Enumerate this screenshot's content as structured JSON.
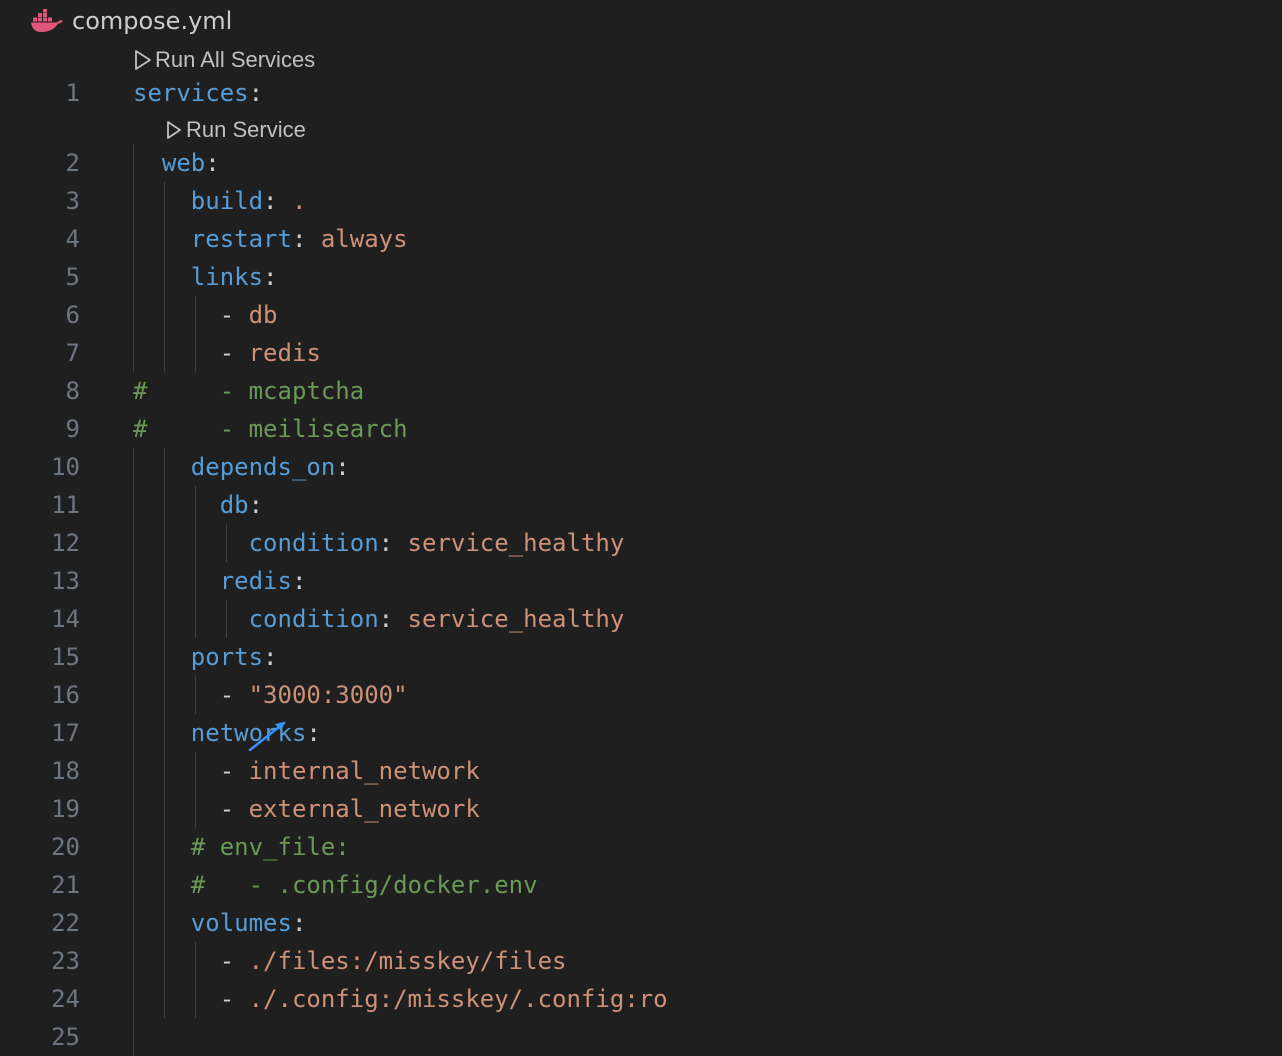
{
  "breadcrumb": {
    "icon": "docker-whale-icon",
    "filename": "compose.yml"
  },
  "codelens": {
    "run_all": "Run All Services",
    "run_service": "Run Service"
  },
  "lines": [
    {
      "n": "1",
      "tokens": [
        {
          "t": "services",
          "c": "k"
        },
        {
          "t": ":",
          "c": "p"
        }
      ]
    },
    {
      "n": "2",
      "tokens": [
        {
          "t": "  ",
          "c": "p"
        },
        {
          "t": "web",
          "c": "k"
        },
        {
          "t": ":",
          "c": "p"
        }
      ]
    },
    {
      "n": "3",
      "tokens": [
        {
          "t": "    ",
          "c": "p"
        },
        {
          "t": "build",
          "c": "k"
        },
        {
          "t": ": ",
          "c": "p"
        },
        {
          "t": ".",
          "c": "s"
        }
      ]
    },
    {
      "n": "4",
      "tokens": [
        {
          "t": "    ",
          "c": "p"
        },
        {
          "t": "restart",
          "c": "k"
        },
        {
          "t": ": ",
          "c": "p"
        },
        {
          "t": "always",
          "c": "s"
        }
      ]
    },
    {
      "n": "5",
      "tokens": [
        {
          "t": "    ",
          "c": "p"
        },
        {
          "t": "links",
          "c": "k"
        },
        {
          "t": ":",
          "c": "p"
        }
      ]
    },
    {
      "n": "6",
      "tokens": [
        {
          "t": "      - ",
          "c": "p"
        },
        {
          "t": "db",
          "c": "s"
        }
      ]
    },
    {
      "n": "7",
      "tokens": [
        {
          "t": "      - ",
          "c": "p"
        },
        {
          "t": "redis",
          "c": "s"
        }
      ]
    },
    {
      "n": "8",
      "tokens": [
        {
          "t": "#     - mcaptcha",
          "c": "c"
        }
      ]
    },
    {
      "n": "9",
      "tokens": [
        {
          "t": "#     - meilisearch",
          "c": "c"
        }
      ]
    },
    {
      "n": "10",
      "tokens": [
        {
          "t": "    ",
          "c": "p"
        },
        {
          "t": "depends_on",
          "c": "k"
        },
        {
          "t": ":",
          "c": "p"
        }
      ]
    },
    {
      "n": "11",
      "tokens": [
        {
          "t": "      ",
          "c": "p"
        },
        {
          "t": "db",
          "c": "k"
        },
        {
          "t": ":",
          "c": "p"
        }
      ]
    },
    {
      "n": "12",
      "tokens": [
        {
          "t": "        ",
          "c": "p"
        },
        {
          "t": "condition",
          "c": "k"
        },
        {
          "t": ": ",
          "c": "p"
        },
        {
          "t": "service_healthy",
          "c": "s"
        }
      ]
    },
    {
      "n": "13",
      "tokens": [
        {
          "t": "      ",
          "c": "p"
        },
        {
          "t": "redis",
          "c": "k"
        },
        {
          "t": ":",
          "c": "p"
        }
      ]
    },
    {
      "n": "14",
      "tokens": [
        {
          "t": "        ",
          "c": "p"
        },
        {
          "t": "condition",
          "c": "k"
        },
        {
          "t": ": ",
          "c": "p"
        },
        {
          "t": "service_healthy",
          "c": "s"
        }
      ]
    },
    {
      "n": "15",
      "tokens": [
        {
          "t": "    ",
          "c": "p"
        },
        {
          "t": "ports",
          "c": "k"
        },
        {
          "t": ":",
          "c": "p"
        }
      ]
    },
    {
      "n": "16",
      "tokens": [
        {
          "t": "      - ",
          "c": "p"
        },
        {
          "t": "\"3000:3000\"",
          "c": "s"
        }
      ]
    },
    {
      "n": "17",
      "tokens": [
        {
          "t": "    ",
          "c": "p"
        },
        {
          "t": "networks",
          "c": "k"
        },
        {
          "t": ":",
          "c": "p"
        }
      ]
    },
    {
      "n": "18",
      "tokens": [
        {
          "t": "      - ",
          "c": "p"
        },
        {
          "t": "internal_network",
          "c": "s"
        }
      ]
    },
    {
      "n": "19",
      "tokens": [
        {
          "t": "      - ",
          "c": "p"
        },
        {
          "t": "external_network",
          "c": "s"
        }
      ]
    },
    {
      "n": "20",
      "tokens": [
        {
          "t": "    ",
          "c": "p"
        },
        {
          "t": "# env_file:",
          "c": "c"
        }
      ]
    },
    {
      "n": "21",
      "tokens": [
        {
          "t": "    ",
          "c": "p"
        },
        {
          "t": "#   - .config/docker.env",
          "c": "c"
        }
      ]
    },
    {
      "n": "22",
      "tokens": [
        {
          "t": "    ",
          "c": "p"
        },
        {
          "t": "volumes",
          "c": "k"
        },
        {
          "t": ":",
          "c": "p"
        }
      ]
    },
    {
      "n": "23",
      "tokens": [
        {
          "t": "      - ",
          "c": "p"
        },
        {
          "t": "./files:/misskey/files",
          "c": "s"
        }
      ]
    },
    {
      "n": "24",
      "tokens": [
        {
          "t": "      - ",
          "c": "p"
        },
        {
          "t": "./.config:/misskey/.config:ro",
          "c": "s"
        }
      ]
    },
    {
      "n": "25",
      "tokens": []
    }
  ],
  "colors": {
    "background": "#1f1f1f",
    "key": "#569cd6",
    "string": "#ce9178",
    "comment": "#6a9955",
    "line_number": "#6e7681",
    "docker": "#e0557a"
  }
}
